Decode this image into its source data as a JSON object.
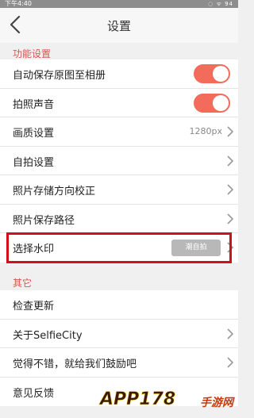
{
  "status_bar": {
    "time": "下午4:40",
    "indicators": "◌ ᯤ 94"
  },
  "header": {
    "title": "设置"
  },
  "section_feature": {
    "title": "功能设置",
    "items": [
      {
        "label": "自动保存原图至相册",
        "type": "toggle",
        "on": true
      },
      {
        "label": "拍照声音",
        "type": "toggle",
        "on": true
      },
      {
        "label": "画质设置",
        "type": "value",
        "value": "1280px"
      },
      {
        "label": "自拍设置",
        "type": "nav"
      },
      {
        "label": "照片存储方向校正",
        "type": "nav"
      },
      {
        "label": "照片保存路径",
        "type": "nav"
      },
      {
        "label": "选择水印",
        "type": "watermark",
        "badge": "潮自拍"
      }
    ]
  },
  "section_other": {
    "title": "其它",
    "items": [
      {
        "label": "检查更新",
        "type": "plain"
      },
      {
        "label": "关于SelfieCity",
        "type": "nav"
      },
      {
        "label": "觉得不错，就给我们鼓励吧",
        "type": "nav"
      },
      {
        "label": "意见反馈",
        "type": "plain"
      }
    ]
  },
  "watermark_logo": {
    "number": "APP178",
    "site": "手游网"
  },
  "colors": {
    "accent": "#f26b5b",
    "highlight_border": "#d0101b",
    "section_title": "#d9534f"
  }
}
